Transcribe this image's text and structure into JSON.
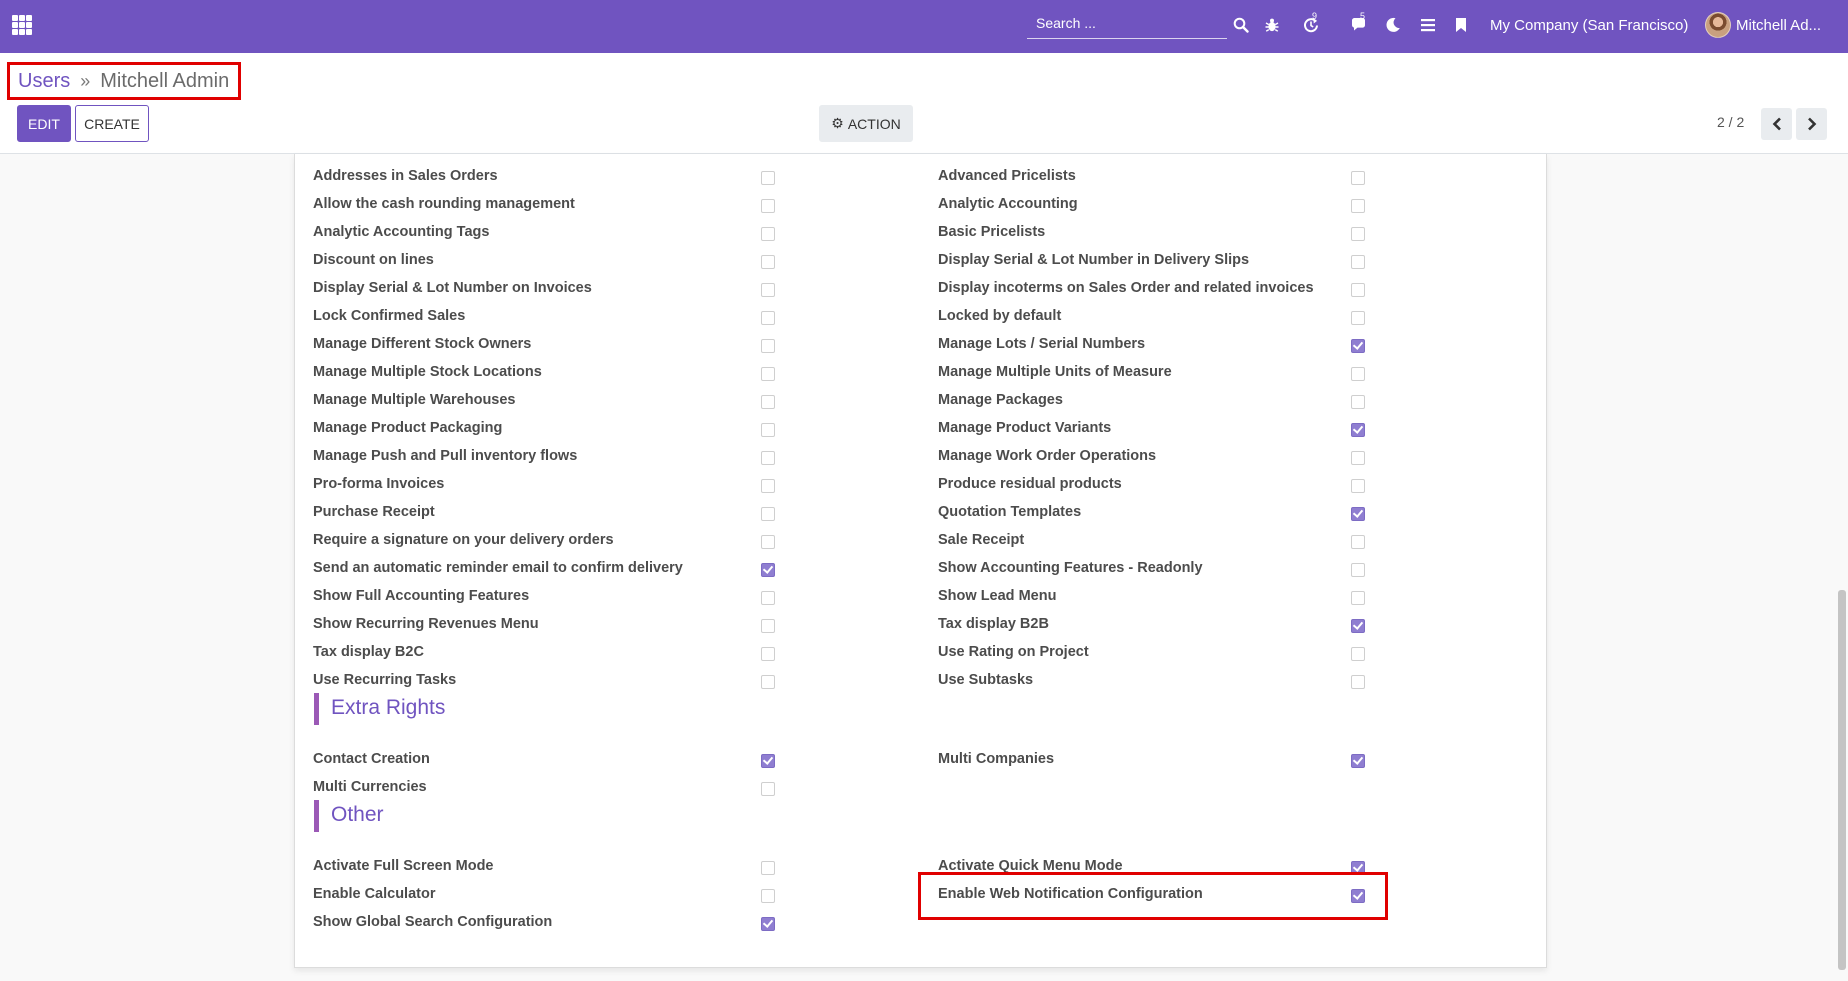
{
  "navbar": {
    "search_placeholder": "Search ...",
    "activity_count": "9",
    "message_count": "5",
    "company": "My Company (San Francisco)",
    "user": "Mitchell Ad..."
  },
  "breadcrumb": {
    "parent": "Users",
    "current": "Mitchell Admin"
  },
  "toolbar": {
    "edit": "EDIT",
    "create": "CREATE",
    "action": "ACTION"
  },
  "pager": {
    "text": "2 / 2"
  },
  "technical_settings": {
    "left": [
      {
        "label": "Addresses in Sales Orders",
        "checked": false
      },
      {
        "label": "Allow the cash rounding management",
        "checked": false
      },
      {
        "label": "Analytic Accounting Tags",
        "checked": false
      },
      {
        "label": "Discount on lines",
        "checked": false
      },
      {
        "label": "Display Serial & Lot Number on Invoices",
        "checked": false
      },
      {
        "label": "Lock Confirmed Sales",
        "checked": false
      },
      {
        "label": "Manage Different Stock Owners",
        "checked": false
      },
      {
        "label": "Manage Multiple Stock Locations",
        "checked": false
      },
      {
        "label": "Manage Multiple Warehouses",
        "checked": false
      },
      {
        "label": "Manage Product Packaging",
        "checked": false
      },
      {
        "label": "Manage Push and Pull inventory flows",
        "checked": false
      },
      {
        "label": "Pro-forma Invoices",
        "checked": false
      },
      {
        "label": "Purchase Receipt",
        "checked": false
      },
      {
        "label": "Require a signature on your delivery orders",
        "checked": false
      },
      {
        "label": "Send an automatic reminder email to confirm delivery",
        "checked": true
      },
      {
        "label": "Show Full Accounting Features",
        "checked": false
      },
      {
        "label": "Show Recurring Revenues Menu",
        "checked": false
      },
      {
        "label": "Tax display B2C",
        "checked": false
      },
      {
        "label": "Use Recurring Tasks",
        "checked": false
      }
    ],
    "right": [
      {
        "label": "Advanced Pricelists",
        "checked": false
      },
      {
        "label": "Analytic Accounting",
        "checked": false
      },
      {
        "label": "Basic Pricelists",
        "checked": false
      },
      {
        "label": "Display Serial & Lot Number in Delivery Slips",
        "checked": false
      },
      {
        "label": "Display incoterms on Sales Order and related invoices",
        "checked": false
      },
      {
        "label": "Locked by default",
        "checked": false
      },
      {
        "label": "Manage Lots / Serial Numbers",
        "checked": true
      },
      {
        "label": "Manage Multiple Units of Measure",
        "checked": false
      },
      {
        "label": "Manage Packages",
        "checked": false
      },
      {
        "label": "Manage Product Variants",
        "checked": true
      },
      {
        "label": "Manage Work Order Operations",
        "checked": false
      },
      {
        "label": "Produce residual products",
        "checked": false
      },
      {
        "label": "Quotation Templates",
        "checked": true
      },
      {
        "label": "Sale Receipt",
        "checked": false
      },
      {
        "label": "Show Accounting Features - Readonly",
        "checked": false
      },
      {
        "label": "Show Lead Menu",
        "checked": false
      },
      {
        "label": "Tax display B2B",
        "checked": true
      },
      {
        "label": "Use Rating on Project",
        "checked": false
      },
      {
        "label": "Use Subtasks",
        "checked": false
      }
    ]
  },
  "extra_rights": {
    "title": "Extra Rights",
    "left": [
      {
        "label": "Contact Creation",
        "checked": true
      },
      {
        "label": "Multi Currencies",
        "checked": false
      }
    ],
    "right": [
      {
        "label": "Multi Companies",
        "checked": true
      }
    ]
  },
  "other": {
    "title": "Other",
    "left": [
      {
        "label": "Activate Full Screen Mode",
        "checked": false
      },
      {
        "label": "Enable Calculator",
        "checked": false
      },
      {
        "label": "Show Global Search Configuration",
        "checked": true
      }
    ],
    "right": [
      {
        "label": "Activate Quick Menu Mode",
        "checked": true
      },
      {
        "label": "Enable Web Notification Configuration",
        "checked": true
      }
    ]
  },
  "colors": {
    "brand": "#7054c0",
    "section_bar": "#9b59b6",
    "checked": "#8f7ed1",
    "highlight": "#e00000"
  }
}
